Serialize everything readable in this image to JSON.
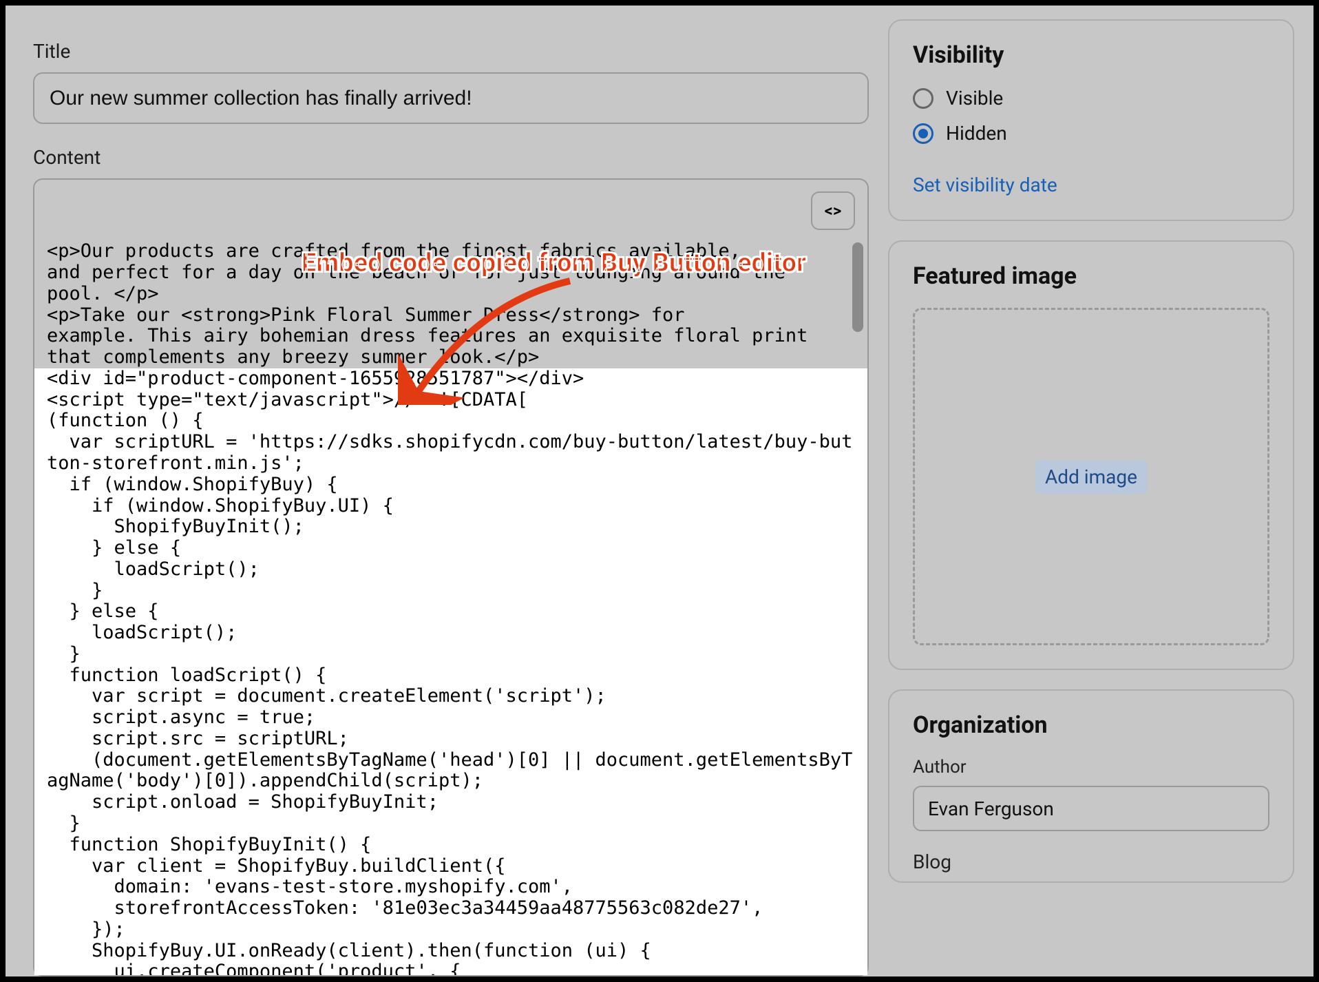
{
  "main": {
    "title_label": "Title",
    "title_value": "Our new summer collection has finally arrived!",
    "content_label": "Content",
    "code_dim": "<p>Our products are crafted from the finest fabrics available,\nand perfect for a day on the beach or for just lounging around the\npool. </p>\n<p>Take our <strong>Pink Floral Summer Dress</strong> for\nexample. This airy bohemian dress features an exquisite floral print\nthat complements any breezy summer look.</p>",
    "code_bright": "<div id=\"product-component-1655928551787\"></div>\n<script type=\"text/javascript\">// <![CDATA[\n(function () {\n  var scriptURL = 'https://sdks.shopifycdn.com/buy-button/latest/buy-button-storefront.min.js';\n  if (window.ShopifyBuy) {\n    if (window.ShopifyBuy.UI) {\n      ShopifyBuyInit();\n    } else {\n      loadScript();\n    }\n  } else {\n    loadScript();\n  }\n  function loadScript() {\n    var script = document.createElement('script');\n    script.async = true;\n    script.src = scriptURL;\n    (document.getElementsByTagName('head')[0] || document.getElementsByTagName('body')[0]).appendChild(script);\n    script.onload = ShopifyBuyInit;\n  }\n  function ShopifyBuyInit() {\n    var client = ShopifyBuy.buildClient({\n      domain: 'evans-test-store.myshopify.com',\n      storefrontAccessToken: '81e03ec3a34459aa48775563c082de27',\n    });\n    ShopifyBuy.UI.onReady(client).then(function (ui) {\n      ui.createComponent('product', {",
    "code_toggle_glyph": "<>"
  },
  "annotation": {
    "text": "Embed code copied from Buy Button editor"
  },
  "sidebar": {
    "visibility": {
      "title": "Visibility",
      "options": [
        "Visible",
        "Hidden"
      ],
      "selected_index": 1,
      "link": "Set visibility date"
    },
    "featured_image": {
      "title": "Featured image",
      "add_label": "Add image"
    },
    "organization": {
      "title": "Organization",
      "author_label": "Author",
      "author_value": "Evan Ferguson",
      "cutoff_label": "Blog"
    }
  }
}
